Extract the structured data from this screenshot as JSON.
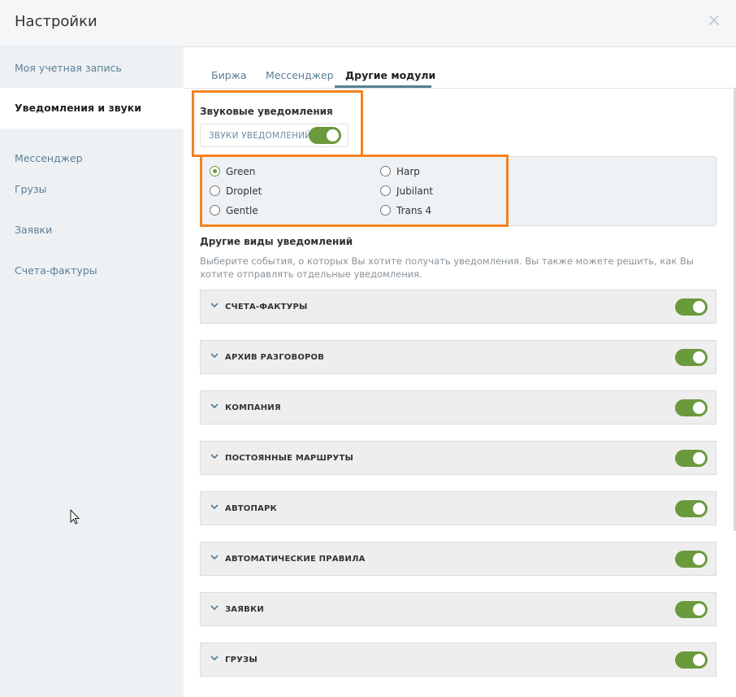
{
  "header": {
    "title": "Настройки",
    "close": "×"
  },
  "sidebar": {
    "items": [
      {
        "label": "Моя учетная запись"
      },
      {
        "label": "Уведомления и звуки"
      },
      {
        "label": "Мессенджер"
      },
      {
        "label": "Грузы"
      },
      {
        "label": "Заявки"
      },
      {
        "label": "Счета-фактуры"
      }
    ]
  },
  "tabs": [
    {
      "label": "Биржа"
    },
    {
      "label": "Мессенджер"
    },
    {
      "label": "Другие модули"
    }
  ],
  "sound": {
    "title": "Звуковые уведомления",
    "toggle_label": "ЗВУКИ УВЕДОМЛЕНИЙ",
    "toggle_on": true,
    "options": [
      {
        "label": "Green",
        "checked": true
      },
      {
        "label": "Harp",
        "checked": false
      },
      {
        "label": "Droplet",
        "checked": false
      },
      {
        "label": "Jubilant",
        "checked": false
      },
      {
        "label": "Gentle",
        "checked": false
      },
      {
        "label": "Trans 4",
        "checked": false
      }
    ]
  },
  "other": {
    "title": "Другие виды уведомлений",
    "description": "Выберите события, о которых Вы хотите получать уведомления. Вы также можете решить, как Вы хотите отправлять отдельные уведомления.",
    "rows": [
      {
        "label": "СЧЕТА-ФАКТУРЫ",
        "on": true
      },
      {
        "label": "АРХИВ РАЗГОВОРОВ",
        "on": true
      },
      {
        "label": "КОМПАНИЯ",
        "on": true
      },
      {
        "label": "ПОСТОЯННЫЕ МАРШРУТЫ",
        "on": true
      },
      {
        "label": "АВТОПАРК",
        "on": true
      },
      {
        "label": "АВТОМАТИЧЕСКИЕ ПРАВИЛА",
        "on": true
      },
      {
        "label": "ЗАЯВКИ",
        "on": true
      },
      {
        "label": "ГРУЗЫ",
        "on": true
      }
    ]
  },
  "colors": {
    "accent_green": "#6a9a3c",
    "highlight_orange": "#f58220",
    "link_blue": "#5a7e95"
  }
}
